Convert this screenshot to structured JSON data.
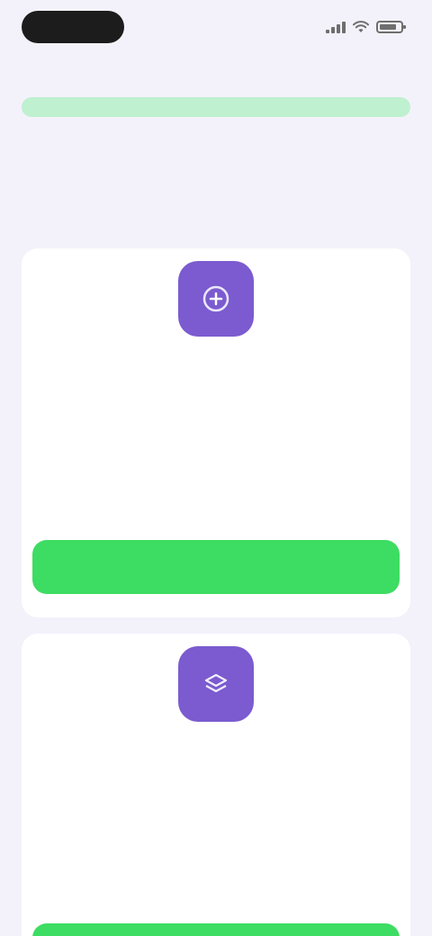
{
  "status_bar": {
    "time": "",
    "icons": [
      "signal-icon",
      "wifi-icon",
      "battery-icon"
    ]
  },
  "progress": {
    "value_percent": 100,
    "color": "#bff0cf",
    "track_color": "#dff5e6"
  },
  "heading": {
    "text": ""
  },
  "cards": [
    {
      "icon": "add-icon",
      "icon_color": "#7b5bcf",
      "title": "",
      "description": "",
      "price": "",
      "button_label": "",
      "button_color": "#3ddc62"
    },
    {
      "icon": "layers-icon",
      "icon_color": "#7b5bcf",
      "title": "",
      "description": "",
      "price": "",
      "button_label": "",
      "button_color": "#3ddc62"
    }
  ]
}
